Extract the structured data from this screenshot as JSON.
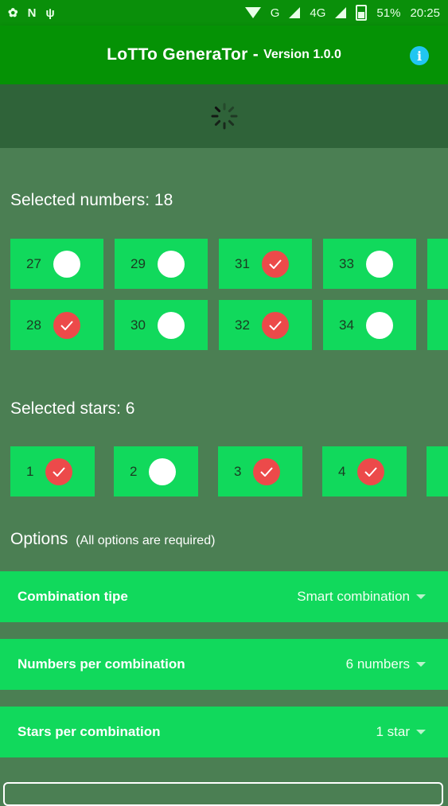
{
  "status_bar": {
    "network_g": "G",
    "network_4g": "4G",
    "battery": "51%",
    "time": "20:25"
  },
  "app_bar": {
    "title": "LoTTo GeneraTor -",
    "version": "Version 1.0.0",
    "info_icon": "info-icon"
  },
  "numbers_section": {
    "heading": "Selected numbers: 18",
    "tiles": [
      {
        "label": "27",
        "checked": false
      },
      {
        "label": "29",
        "checked": false
      },
      {
        "label": "31",
        "checked": true
      },
      {
        "label": "33",
        "checked": false
      },
      {
        "label": "28",
        "checked": true
      },
      {
        "label": "30",
        "checked": false
      },
      {
        "label": "32",
        "checked": true
      },
      {
        "label": "34",
        "checked": false
      }
    ]
  },
  "stars_section": {
    "heading": "Selected stars: 6",
    "tiles": [
      {
        "label": "1",
        "checked": true
      },
      {
        "label": "2",
        "checked": false
      },
      {
        "label": "3",
        "checked": true
      },
      {
        "label": "4",
        "checked": true
      }
    ]
  },
  "options": {
    "heading": "Options",
    "note": "(All options are required)",
    "rows": [
      {
        "label": "Combination tipe",
        "value": "Smart combination"
      },
      {
        "label": "Numbers per combination",
        "value": "6 numbers"
      },
      {
        "label": "Stars per combination",
        "value": "1 star"
      }
    ]
  },
  "colors": {
    "accent_green": "#11d95c",
    "app_bar": "#059205",
    "checked_red": "#ec4a4a"
  }
}
